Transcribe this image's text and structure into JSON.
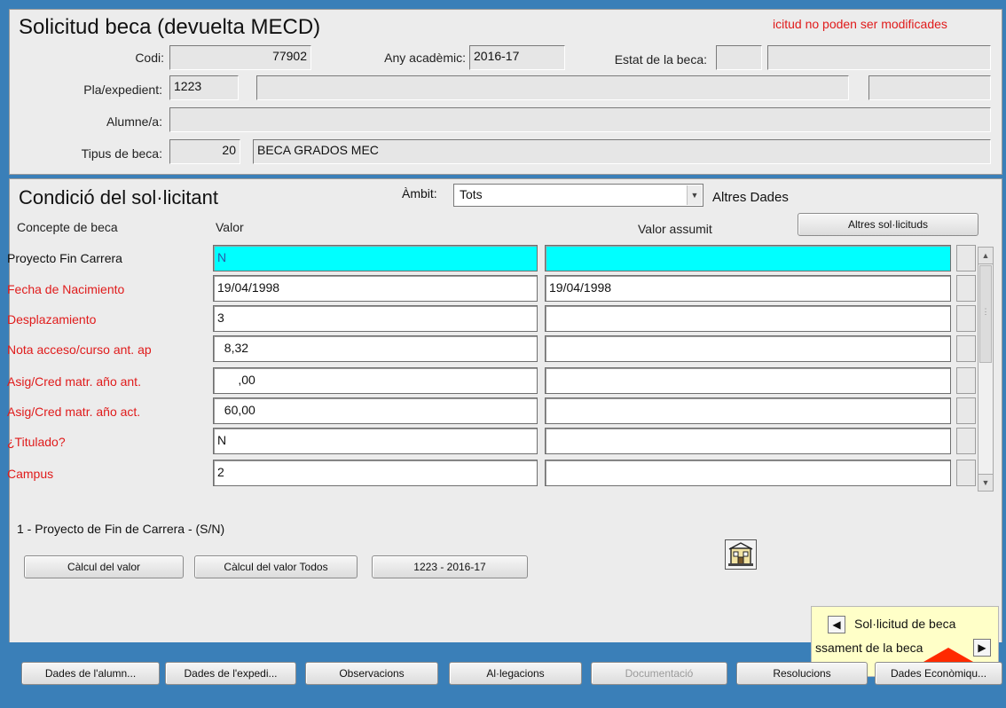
{
  "header": {
    "title": "Solicitud beca (devuelta MECD)",
    "warning": "icitud no poden ser modificades",
    "codi_label": "Codi:",
    "codi_value": "77902",
    "any_label": "Any acadèmic:",
    "any_value": "2016-17",
    "estat_label": "Estat de la beca:",
    "pla_label": "Pla/expedient:",
    "pla_value": "1223",
    "alumne_label": "Alumne/a:",
    "tipus_label": "Tipus de beca:",
    "tipus_code": "20",
    "tipus_desc": "BECA GRADOS MEC"
  },
  "condicio": {
    "title": "Condició del sol·licitant",
    "ambit_label": "Àmbit:",
    "ambit_value": "Tots",
    "altres_dades": "Altres Dades",
    "col_concepte": "Concepte de beca",
    "col_valor": "Valor",
    "col_valor_assumit": "Valor assumit",
    "altres_sol_button": "Altres sol·licituds",
    "rows": [
      {
        "label": "Proyecto Fin Carrera",
        "valor": "N",
        "assumit": ""
      },
      {
        "label": "Fecha de Nacimiento",
        "valor": "19/04/1998",
        "assumit": "19/04/1998"
      },
      {
        "label": "Desplazamiento",
        "valor": "3",
        "assumit": ""
      },
      {
        "label": "Nota acceso/curso ant. ap",
        "valor": "  8,32",
        "assumit": ""
      },
      {
        "label": "Asig/Cred matr. año ant.",
        "valor": "      ,00",
        "assumit": ""
      },
      {
        "label": "Asig/Cred matr. año act.",
        "valor": "  60,00",
        "assumit": ""
      },
      {
        "label": "¿Titulado?",
        "valor": "N",
        "assumit": ""
      },
      {
        "label": "Campus",
        "valor": "2",
        "assumit": ""
      }
    ],
    "hint": "1 - Proyecto de Fin de Carrera - (S/N)",
    "calcul_button": "Càlcul del valor",
    "calcul_todos_button": "Càlcul del valor Todos",
    "expedient_button": "1223 - 2016-17"
  },
  "nav": {
    "prev_label": "Sol·licitud de beca",
    "next_label": "ssament de la beca"
  },
  "bottom_tabs": [
    {
      "label": "Dades de l'alumn...",
      "disabled": false
    },
    {
      "label": "Dades de l'expedi...",
      "disabled": false
    },
    {
      "label": "Observacions",
      "disabled": false
    },
    {
      "label": "Al·legacions",
      "disabled": false
    },
    {
      "label": "Documentació",
      "disabled": true
    },
    {
      "label": "Resolucions",
      "disabled": false
    },
    {
      "label": "Dades Econòmiqu...",
      "disabled": false
    }
  ],
  "colors": {
    "background": "#3a7fb8",
    "panel": "#ececec",
    "required_label": "#e01b1b",
    "highlight_row": "#00ffff",
    "nav_box": "#ffffc8",
    "arrow": "#ff2a00"
  }
}
